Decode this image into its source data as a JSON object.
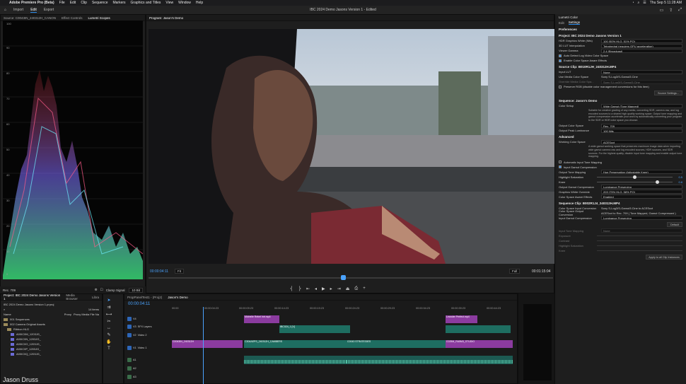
{
  "menubar": {
    "app": "Adobe Premiere Pro (Beta)",
    "items": [
      "File",
      "Edit",
      "Clip",
      "Sequence",
      "Markers",
      "Graphics and Titles",
      "View",
      "Window",
      "Help"
    ],
    "clock": "Thu Sep 5  11:28 AM"
  },
  "header": {
    "tabs": [
      "Import",
      "Edit",
      "Export"
    ],
    "active_tab": "Edit",
    "title": "IBC 2024 Demo Jasons Version 1 - Edited"
  },
  "source_panel": {
    "tabs": [
      "Source: C0043IN_240312H_CANON",
      "Effect Controls",
      "Lumetri Scopes"
    ],
    "active": "Lumetri Scopes",
    "scale": [
      "100",
      "90",
      "80",
      "70",
      "60",
      "50",
      "40",
      "30",
      "20",
      "10",
      "0"
    ],
    "footer_label": "Rec. 709",
    "clamp": "Clamp Signal",
    "bits": "10 Bit"
  },
  "program": {
    "tab": "Program: Jason's Demo",
    "timecode": "00:00:04:11",
    "fit": "Fit",
    "quality": "Full",
    "duration": "00:01:15:04"
  },
  "lumetri": {
    "title": "Lumetri Color",
    "tabs": [
      "Edit",
      "Settings"
    ],
    "active_tab": "Settings",
    "preferences": "Preferences",
    "project_section": "Project: IBC 2024 Demo Jasons Version 1",
    "project_rows": [
      {
        "label": "HDR Graphics White (Nits)",
        "value": "100 (50% HLG, 51% PQ)"
      },
      {
        "label": "3D LUT Interpolation",
        "value": "Tetrahedral (requires GPU acceleration)"
      },
      {
        "label": "Viewer Gamma",
        "value": "2.4 (Broadcast)"
      }
    ],
    "project_checks": [
      "Auto Detect Log Video Color Space",
      "Enable Color Space Aware Effects"
    ],
    "source_section": "Source Clip: B010R1JH_240312H.MP4",
    "input_lut_label": "Input LUT",
    "input_lut": "None",
    "use_media": "Use Media Color Space",
    "use_media_value": "Sony S-Log3/S-Gamut3.Cine",
    "override": "Override Media Color Spa...",
    "override_value": "Sony S-Log3/S-Gamut3.Cine",
    "preserve": "Preserve RGB (disable color management conversions for this item)",
    "source_settings": "Source Settings...",
    "sequence_section": "Sequence: Jason's Demo",
    "color_setup_label": "Color Setup",
    "color_setup": "Wide Gamut (Tone Mapped)",
    "color_setup_desc": "Suitable for creative grading of any media, converting SDR, camera raw, and log encoded sources to a shared high quality working space. Output tone mapping and gamut compression accelerate your work by automatically converting your program to the SDR or HDR color space you choose.",
    "output_space_label": "Output Color Space",
    "output_space": "Rec. 709",
    "output_lum_label": "Output Peak Luminance",
    "output_lum": "100 Nits",
    "advanced": "Advanced",
    "working_label": "Working Color Space",
    "working": "ACEScct",
    "working_desc": "A wide gamut working space that preserves maximum image data when importing wide gamut camera raw and log encoded sources, HDR sources, and SDR sources. For the highest quality, disable input tone mapping and enable output tone mapping.",
    "auto_input_tm": "Automatic Input Tone Mapping",
    "input_gamut": "Input Gamut Compression",
    "output_tm_label": "Output Tone Mapping",
    "output_tm": "Hue Preservation (Adjustable Knee)",
    "hl_sat_label": "Highlight Saturation",
    "hl_sat": "0.5",
    "knee_label": "Knee",
    "knee": "0.8",
    "out_gamut_label": "Output Gamut Compression",
    "out_gamut": "Luminance Preserving",
    "gfx_label": "Graphics White Override",
    "gfx": "203 (75% HLG, 58% PQ)",
    "cs_aware_label": "Color Space Aware Effects",
    "cs_aware": "Enabled",
    "seqclip_section": "Sequence Clip: B002R1J4_240312H.MP4",
    "input_conv_label": "Color Space Input Conversion",
    "input_conv": "Sony S-Log3/S-Gamut3.Cine to ACEScct",
    "output_conv_label": "Color Space Output Conversion",
    "output_conv": "ACEScct to Rec. 709 ( Tone Mapped, Gamut Compressed )",
    "in_gamut_label": "Input Gamut Compression",
    "in_gamut": "Luminance Preserving",
    "default_btn": "Default",
    "itm_label": "Input Tone Mapping",
    "itm": "None",
    "exposure": "Exposure",
    "contrast": "Contrast",
    "hl_saturation": "Highlight Saturation",
    "knee2": "Knee",
    "apply_all": "Apply to all Clip Instances"
  },
  "project_panel": {
    "tabs": [
      "Project: IBC 2024 Demo Jasons Version 1",
      "Media Browser",
      "Libra"
    ],
    "file": "IBC 2024 Demo Jasons Version 1.prproj",
    "count": "14 items",
    "col_name": "Name",
    "col_proxy": "Proxy",
    "col_fr": "Proxy Media File Na",
    "items": [
      "001 Sequences",
      "002 Camera Original Assets",
      "Ribbon HLG",
      "A00IC0M_1203JG_",
      "A00IC0N_1203JG_",
      "A00IC0O_1203JG_",
      "A00IC0P_1203JG_",
      "A00IC0Q_1203JG_"
    ]
  },
  "timeline": {
    "tabs": [
      "PropPanelTest1 - (Proj2)",
      "Jason's Demo"
    ],
    "timecode": "00:00:04:11",
    "ticks": [
      "00:00",
      "00:00:04:23",
      "00:00:09:23",
      "00:00:14:23",
      "00:00:19:23",
      "00:00:24:23",
      "00:00:29:23",
      "00:00:34:23",
      "00:00:39:23",
      "00:00:44:23"
    ],
    "tracks": [
      "V4",
      "V3",
      "V2",
      "V1",
      "A1",
      "A2",
      "A3"
    ],
    "track_names": {
      "V3": "SFX Layers",
      "V2": "Video 2",
      "V1": "Video 1"
    },
    "clip_labels": [
      "Michelle Rebel Intr.mp4",
      "IBC024_1 [V]",
      "C304AEPS_240312H_CAMBERS",
      "C0043 STRATEGIES",
      "C025M_RA5M3_STUDIO",
      "C0043IN_240312H",
      "Leander Perfect.mp4",
      "C0043IN_240312H"
    ]
  },
  "watermark": "Jason Druss"
}
